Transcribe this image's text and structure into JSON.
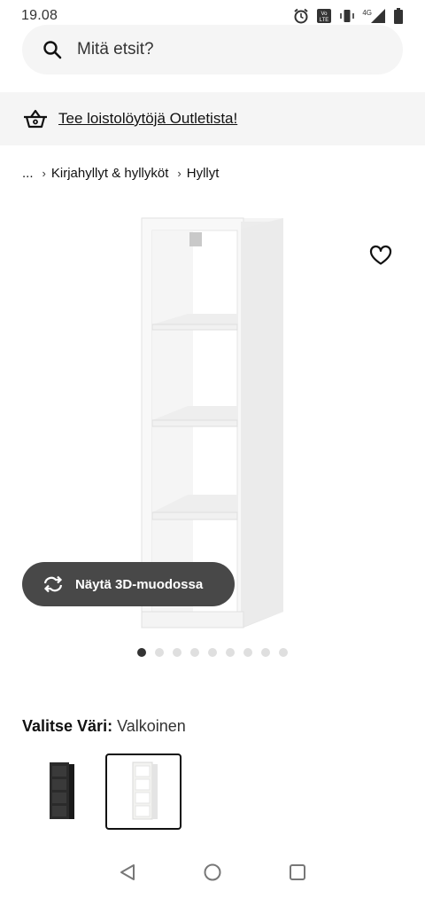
{
  "status_bar": {
    "time": "19.08",
    "icons": [
      "alarm-icon",
      "volte-icon",
      "vibrate-icon",
      "signal-4g-icon",
      "battery-icon"
    ],
    "network_label": "4G"
  },
  "search": {
    "placeholder": "Mitä etsit?"
  },
  "promo": {
    "text": "Tee loistolöytöjä Outletista!",
    "icon": "basket-icon"
  },
  "breadcrumb": {
    "ellipsis": "...",
    "items": [
      "Kirjahyllyt & hyllyköt",
      "Hyllyt"
    ]
  },
  "product": {
    "view3d_label": "Näytä 3D-muodossa",
    "image_count": 9,
    "active_image": 1
  },
  "color_select": {
    "label": "Valitse Väri:",
    "value": "Valkoinen",
    "options": [
      {
        "name": "musta",
        "color": "#2b2b2b",
        "selected": false
      },
      {
        "name": "valkoinen",
        "color": "#f3f3f1",
        "selected": true
      }
    ]
  },
  "colors": {
    "search_bg": "#f5f5f5",
    "button_bg": "#484848",
    "dot_active": "#333333",
    "dot_inactive": "#dfdfdf"
  }
}
